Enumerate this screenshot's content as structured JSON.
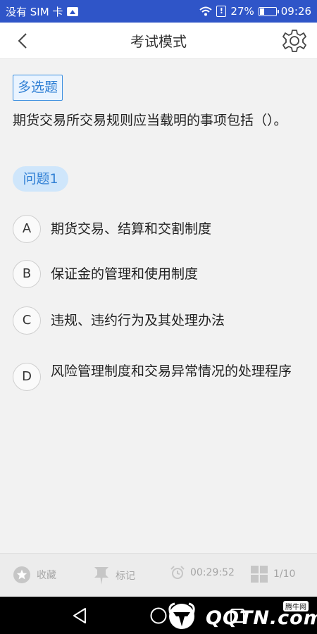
{
  "status": {
    "carrier": "没有 SIM 卡",
    "battery": "27%",
    "time": "09:26"
  },
  "header": {
    "title": "考试模式"
  },
  "question": {
    "type": "多选题",
    "text": "期货交易所交易规则应当载明的事项包括（）。",
    "tag": "问题1"
  },
  "options": [
    {
      "letter": "A",
      "text": "期货交易、结算和交割制度"
    },
    {
      "letter": "B",
      "text": "保证金的管理和使用制度"
    },
    {
      "letter": "C",
      "text": "违规、违约行为及其处理办法"
    },
    {
      "letter": "D",
      "text": "风险管理制度和交易异常情况的处理程序"
    }
  ],
  "toolbar": {
    "favorite": "收藏",
    "mark": "标记",
    "timer": "00:29:52",
    "count": "1/10"
  },
  "watermark": {
    "brand": "QQTN.com",
    "badge": "腾牛网"
  }
}
